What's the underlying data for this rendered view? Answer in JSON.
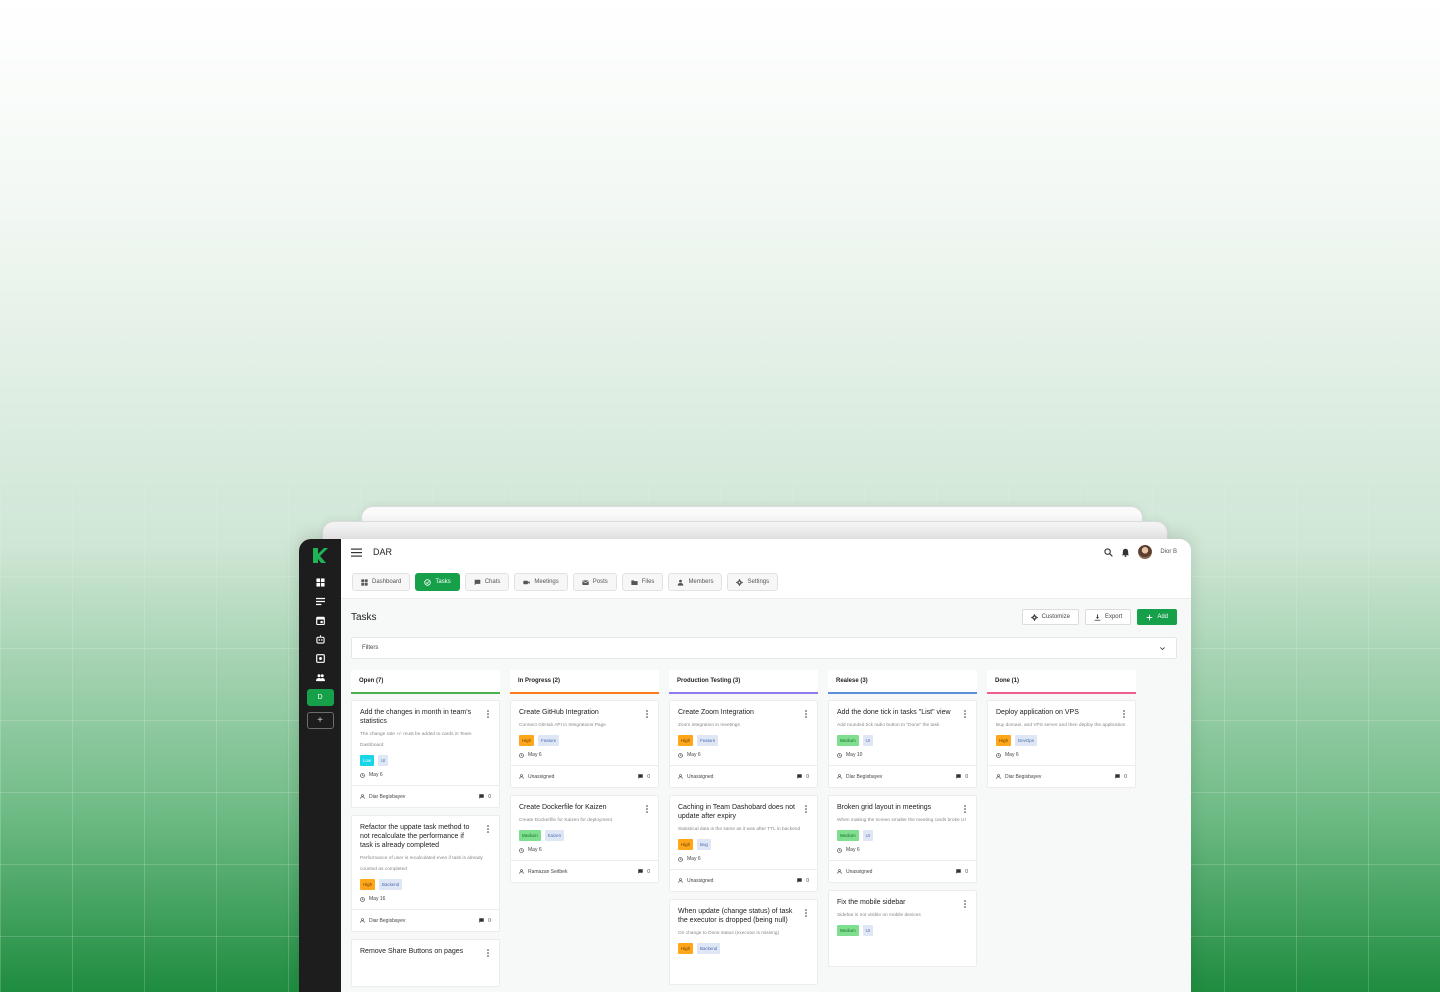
{
  "app": {
    "workspace_title": "DAR",
    "user_name": "Dior B",
    "workspace_initial": "D",
    "add_workspace": "+"
  },
  "colors": {
    "accent": "#16a04a",
    "sidebar": "#1d1d1d",
    "open": "#4caf50",
    "in_progress": "#ff7a1a",
    "production_testing": "#8c7cf0",
    "realese": "#5b8fd9",
    "done": "#ef5d8f"
  },
  "sidebar_icons": [
    "dashboard-icon",
    "lines-icon",
    "calendar-icon",
    "robot-icon",
    "image-icon",
    "members-icon"
  ],
  "tabs": [
    {
      "label": "Dashboard",
      "icon": "dashboard-icon",
      "active": false
    },
    {
      "label": "Tasks",
      "icon": "check-circle-icon",
      "active": true
    },
    {
      "label": "Chats",
      "icon": "chat-icon",
      "active": false
    },
    {
      "label": "Meetings",
      "icon": "video-icon",
      "active": false
    },
    {
      "label": "Posts",
      "icon": "mail-icon",
      "active": false
    },
    {
      "label": "Files",
      "icon": "folder-icon",
      "active": false
    },
    {
      "label": "Members",
      "icon": "person-icon",
      "active": false
    },
    {
      "label": "Settings",
      "icon": "gear-icon",
      "active": false
    }
  ],
  "page": {
    "title": "Tasks",
    "customize": "Customize",
    "export": "Export",
    "add": "Add",
    "filters": "Filters"
  },
  "columns": [
    {
      "title": "Open (7)",
      "color": "#4caf50",
      "cards": [
        {
          "title": "Add the changes in month in team's statistics",
          "desc": "The change rate +/- must be added to cards in Team Dashboard",
          "tags": [
            {
              "label": "Low",
              "bg": "#18d6e8",
              "fg": "#ffffff"
            },
            {
              "label": "UI",
              "bg": "#dfe7f7",
              "fg": "#4a6aa8"
            }
          ],
          "date": "May 6",
          "assignee": "Diar Begisbayev",
          "comments": "0"
        },
        {
          "title": "Refactor the uppate task method to not recalculate the performance if task is already completed",
          "desc": "Performance of user is recalculated even if task is already counted as completed",
          "tags": [
            {
              "label": "High",
              "bg": "#ffa61a",
              "fg": "#6b3e00"
            },
            {
              "label": "Backend",
              "bg": "#dfe7f7",
              "fg": "#4a6aa8"
            }
          ],
          "date": "May 16",
          "assignee": "Diar Begisbayev",
          "comments": "0"
        },
        {
          "title": "Remove Share Buttons on pages",
          "desc": "",
          "tags": [],
          "date": "",
          "assignee": "",
          "comments": ""
        }
      ]
    },
    {
      "title": "In Progress (2)",
      "color": "#ff7a1a",
      "cards": [
        {
          "title": "Create GitHub Integration",
          "desc": "Connect GitHub API in Integrations Page",
          "tags": [
            {
              "label": "High",
              "bg": "#ffa61a",
              "fg": "#6b3e00"
            },
            {
              "label": "Feature",
              "bg": "#dfe7f7",
              "fg": "#4a6aa8"
            }
          ],
          "date": "May 6",
          "assignee": "Unassigned",
          "comments": "0"
        },
        {
          "title": "Create Dockerfile for Kaizen",
          "desc": "Create Dockerfile for Kaizen for deployment",
          "tags": [
            {
              "label": "Medium",
              "bg": "#7ee08e",
              "fg": "#1f6a2c"
            },
            {
              "label": "Kaizen",
              "bg": "#dfe7f7",
              "fg": "#4a6aa8"
            }
          ],
          "date": "May 6",
          "assignee": "Ramazan Seitbek",
          "comments": "0"
        }
      ]
    },
    {
      "title": "Production Testing (3)",
      "color": "#8c7cf0",
      "cards": [
        {
          "title": "Create Zoom Integration",
          "desc": "Zoom integration in meetings",
          "tags": [
            {
              "label": "High",
              "bg": "#ffa61a",
              "fg": "#6b3e00"
            },
            {
              "label": "Feature",
              "bg": "#dfe7f7",
              "fg": "#4a6aa8"
            }
          ],
          "date": "May 6",
          "assignee": "Unassigned",
          "comments": "0"
        },
        {
          "title": "Caching in Team Dashobard does not update after expiry",
          "desc": "Statistical data is the same as it was after TTL in backend",
          "tags": [
            {
              "label": "High",
              "bg": "#ffa61a",
              "fg": "#6b3e00"
            },
            {
              "label": "Bug",
              "bg": "#dfe7f7",
              "fg": "#4a6aa8"
            }
          ],
          "date": "May 6",
          "assignee": "Unassigned",
          "comments": "0"
        },
        {
          "title": "When update (change status) of task the executor is dropped (being null)",
          "desc": "On change to Done status (executor is missing)",
          "tags": [
            {
              "label": "High",
              "bg": "#ffa61a",
              "fg": "#6b3e00"
            },
            {
              "label": "Backend",
              "bg": "#dfe7f7",
              "fg": "#4a6aa8"
            }
          ],
          "date": "",
          "assignee": "",
          "comments": ""
        }
      ]
    },
    {
      "title": "Realese (3)",
      "color": "#5b8fd9",
      "cards": [
        {
          "title": "Add the done tick in tasks \"List\" view",
          "desc": "Add rounded tick radio button to \"Done\" the task",
          "tags": [
            {
              "label": "Medium",
              "bg": "#7ee08e",
              "fg": "#1f6a2c"
            },
            {
              "label": "UI",
              "bg": "#dfe7f7",
              "fg": "#4a6aa8"
            }
          ],
          "date": "May 10",
          "assignee": "Diar Begisbayev",
          "comments": "0"
        },
        {
          "title": "Broken grid layout in meetings",
          "desc": "When making the screen smaller the meeting cards broke UI",
          "tags": [
            {
              "label": "Medium",
              "bg": "#7ee08e",
              "fg": "#1f6a2c"
            },
            {
              "label": "UI",
              "bg": "#dfe7f7",
              "fg": "#4a6aa8"
            }
          ],
          "date": "May 6",
          "assignee": "Unassigned",
          "comments": "0"
        },
        {
          "title": "Fix the mobile sidebar",
          "desc": "Sidebar is not visible on mobile devices",
          "tags": [
            {
              "label": "Medium",
              "bg": "#7ee08e",
              "fg": "#1f6a2c"
            },
            {
              "label": "UI",
              "bg": "#dfe7f7",
              "fg": "#4a6aa8"
            }
          ],
          "date": "",
          "assignee": "",
          "comments": ""
        }
      ]
    },
    {
      "title": "Done (1)",
      "color": "#ef5d8f",
      "cards": [
        {
          "title": "Deploy application on VPS",
          "desc": "Buy domain, and VPS server and then deploy the application",
          "tags": [
            {
              "label": "High",
              "bg": "#ffa61a",
              "fg": "#6b3e00"
            },
            {
              "label": "DevOps",
              "bg": "#dfe7f7",
              "fg": "#4a6aa8"
            }
          ],
          "date": "May 6",
          "assignee": "Diar Begisbayev",
          "comments": "0"
        }
      ]
    }
  ]
}
